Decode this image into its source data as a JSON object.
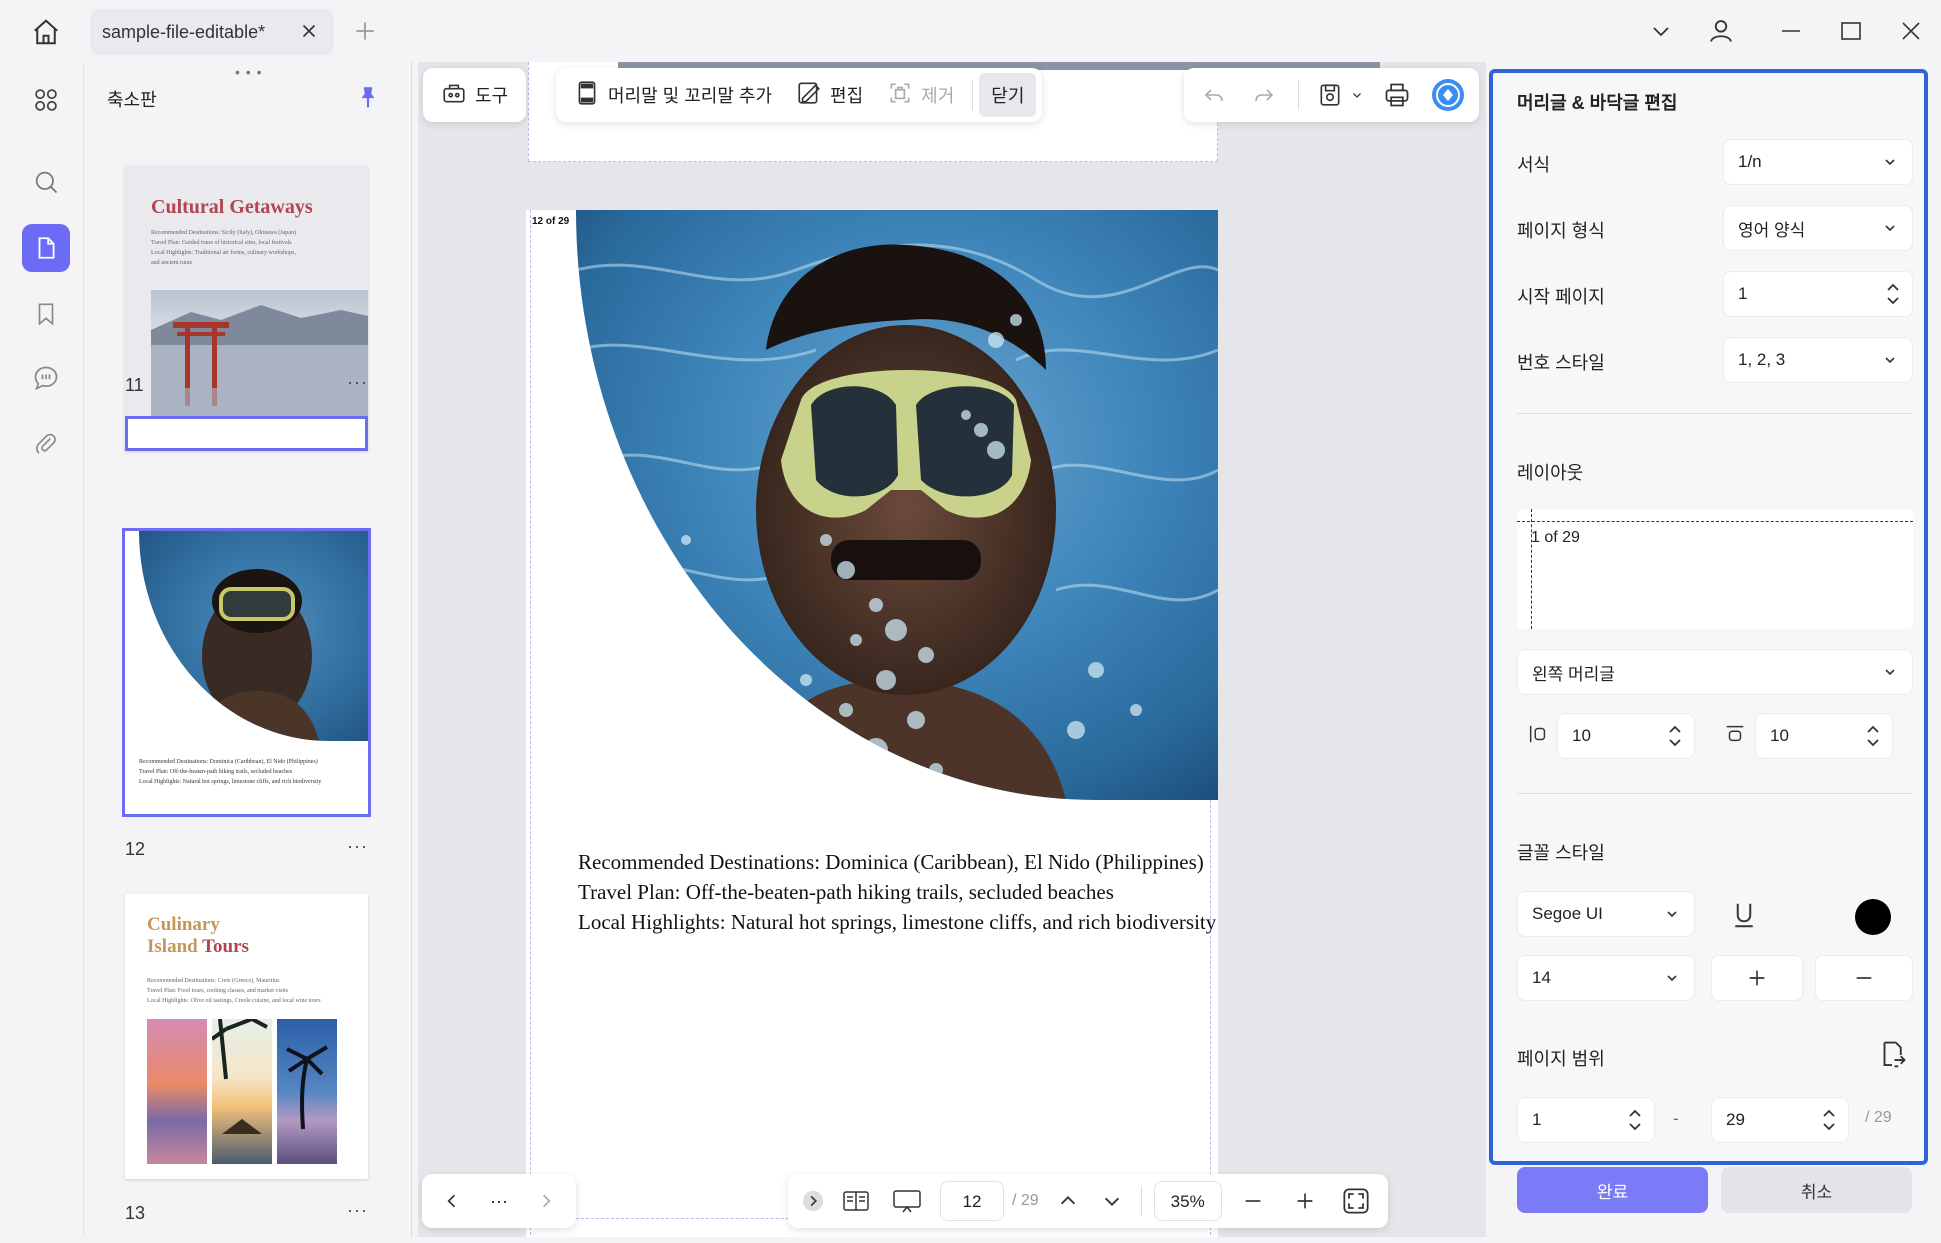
{
  "tab": {
    "title": "sample-file-editable*"
  },
  "thumbnails": {
    "title": "축소판",
    "pages": [
      {
        "num": "11",
        "title": "Cultural Getaways",
        "lines": [
          "Recommended Destinations: Sicily (Italy), Okinawa (Japan)",
          "Travel Plan: Guided tours of historical sites, local festivals",
          "Local Highlights: Traditional art forms, culinary workshops,",
          "and ancient ruins"
        ]
      },
      {
        "num": "12",
        "lines": [
          "Recommended Destinations: Dominica (Caribbean), El Nido (Philippines)",
          "Travel Plan: Off-the-beaten-path hiking trails, secluded beaches",
          "Local Highlights: Natural hot springs, limestone cliffs, and rich biodiversity"
        ]
      },
      {
        "num": "13",
        "title_a": "Culinary",
        "title_b": "Island",
        "title_c": "Tours",
        "lines": [
          "Recommended Destinations: Crete (Greece), Mauritius",
          "Travel Plan: Food tours, cooking classes, and market visits",
          "Local Highlights: Olive oil tastings, Creole cuisine, and local wine tours"
        ]
      }
    ],
    "more": "···"
  },
  "toolbar": {
    "tools_label": "도구",
    "add_header_footer": "머리말 및 꼬리말 추가",
    "edit": "편집",
    "remove": "제거",
    "close": "닫기"
  },
  "page": {
    "header_label": "12 of 29",
    "lines": [
      "Recommended Destinations: Dominica (Caribbean), El Nido (Philippines)",
      "Travel Plan: Off-the-beaten-path hiking trails, secluded beaches",
      "Local Highlights: Natural hot springs, limestone cliffs, and rich biodiversity"
    ]
  },
  "bottom_bar": {
    "more": "···",
    "current_page": "12",
    "total_pages": "/ 29",
    "zoom": "35%"
  },
  "panel": {
    "title": "머리글 & 바닥글 편집",
    "format_label": "서식",
    "format_value": "1/n",
    "page_format_label": "페이지 형식",
    "page_format_value": "영어 양식",
    "start_page_label": "시작 페이지",
    "start_page_value": "1",
    "number_style_label": "번호 스타일",
    "number_style_value": "1, 2, 3",
    "layout_label": "레이아웃",
    "layout_preview": "1 of 29",
    "position_value": "왼쪽 머리글",
    "margin_left": "10",
    "margin_top": "10",
    "font_style_label": "글꼴 스타일",
    "font_family": "Segoe UI",
    "font_size": "14",
    "text_color": "#000000",
    "page_range_label": "페이지 범위",
    "range_from": "1",
    "range_dash": "-",
    "range_to": "29",
    "range_total": "/ 29",
    "done": "완료",
    "cancel": "취소"
  },
  "colors": {
    "accent": "#6b6bf5",
    "panel_border": "#2f64d8"
  }
}
